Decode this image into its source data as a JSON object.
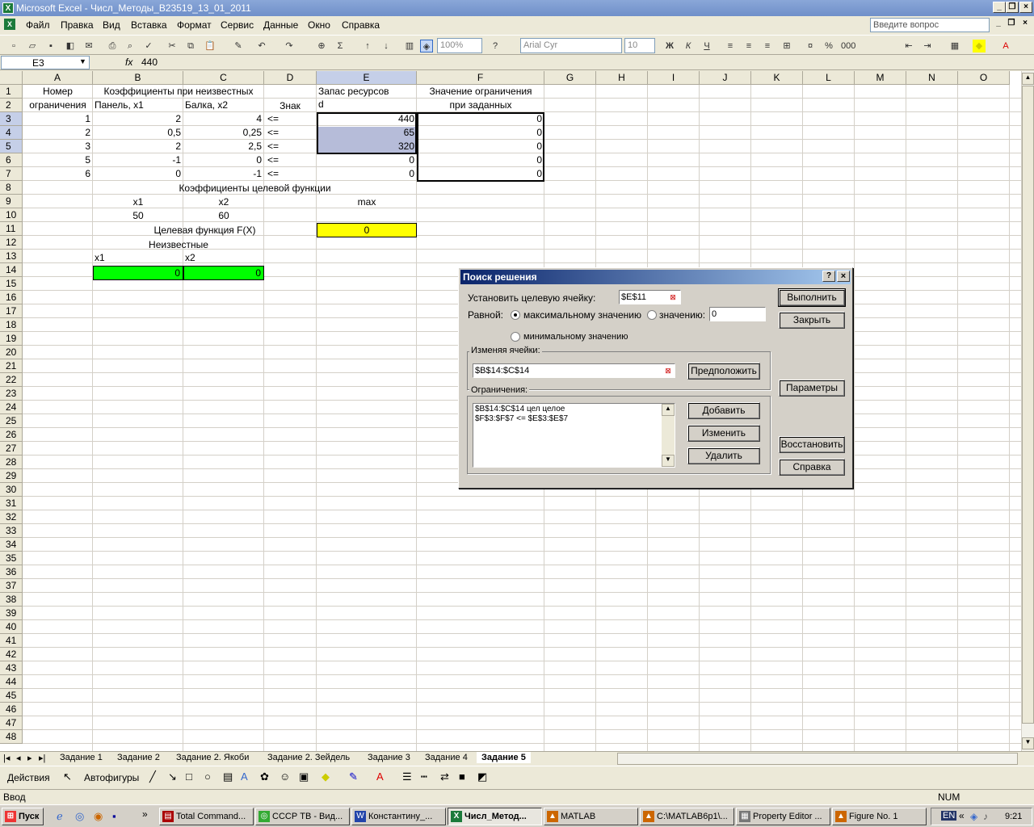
{
  "window": {
    "title": "Microsoft Excel - Числ_Методы_B23519_13_01_2011",
    "icon": "X"
  },
  "menu": [
    "Файл",
    "Правка",
    "Вид",
    "Вставка",
    "Формат",
    "Сервис",
    "Данные",
    "Окно",
    "Справка"
  ],
  "askbox": "Введите вопрос",
  "toolbar": {
    "zoom": "100%",
    "font": "Arial Cyr",
    "size": "10",
    "bold": "Ж",
    "italic": "К",
    "underline": "Ч"
  },
  "formula": {
    "cell": "E3",
    "fx": "fx",
    "value": "440"
  },
  "columns": [
    "A",
    "B",
    "C",
    "D",
    "E",
    "F",
    "G",
    "H",
    "I",
    "J",
    "K",
    "L",
    "M",
    "N",
    "O"
  ],
  "rows": [
    "1",
    "2",
    "3",
    "4",
    "5",
    "6",
    "7",
    "8",
    "9",
    "10",
    "11",
    "12",
    "13",
    "14",
    "15",
    "16",
    "17",
    "18",
    "19",
    "20",
    "21",
    "22",
    "23",
    "24",
    "25",
    "26",
    "27",
    "28",
    "29",
    "30",
    "31",
    "32",
    "33",
    "34",
    "35",
    "36",
    "37",
    "38",
    "39",
    "40",
    "41",
    "42",
    "43",
    "44",
    "45",
    "46",
    "47",
    "48"
  ],
  "sheet": {
    "A1": "Номер",
    "A2": "ограничения",
    "B1": "Коэффициенты при неизвестных",
    "B2": "Панель, x1",
    "C2": "Балка, x2",
    "D2": "Знак",
    "E1": "Запас ресурсов",
    "E2": "d",
    "F1": "Значение ограничения",
    "F2": "при заданных",
    "rows": [
      {
        "a": "1",
        "b": "2",
        "c": "4",
        "d": "<=",
        "e": "440",
        "f": "0"
      },
      {
        "a": "2",
        "b": "0,5",
        "c": "0,25",
        "d": "<=",
        "e": "65",
        "f": "0"
      },
      {
        "a": "3",
        "b": "2",
        "c": "2,5",
        "d": "<=",
        "e": "320",
        "f": "0"
      },
      {
        "a": "5",
        "b": "-1",
        "c": "0",
        "d": "<=",
        "e": "0",
        "f": "0"
      },
      {
        "a": "6",
        "b": "0",
        "c": "-1",
        "d": "<=",
        "e": "0",
        "f": "0"
      }
    ],
    "B8": "Коэффициенты целевой функции",
    "B9": "x1",
    "C9": "x2",
    "E9": "max",
    "B10": "50",
    "C10": "60",
    "B11": "Целевая функция F(X)",
    "E11": "0",
    "B12": "Неизвестные",
    "B13": "x1",
    "C13": "x2",
    "B14": "0",
    "C14": "0",
    "colors": {
      "yellow": "#ffff00",
      "green": "#00ff00",
      "selection": "#b6bcd9"
    }
  },
  "sheettabs": [
    "Задание 1",
    "Задание 2",
    "Задание 2. Якоби",
    "Задание 2. Зейдель",
    "Задание 3",
    "Задание 4",
    "Задание 5"
  ],
  "activeSheet": "Задание 5",
  "drawbar": {
    "actions": "Действия",
    "autoshapes": "Автофигуры"
  },
  "status": {
    "left": "Ввод",
    "num": "NUM"
  },
  "taskbar": {
    "start": "Пуск",
    "tasks": [
      "Total Command...",
      "СССР ТВ - Вид...",
      "Константину_...",
      "Числ_Метод...",
      "MATLAB",
      "C:\\MATLAB6p1\\...",
      "Property Editor ...",
      "Figure No. 1"
    ],
    "lang": "EN",
    "time": "9:21"
  },
  "dialog": {
    "title": "Поиск решения",
    "target_label": "Установить целевую ячейку:",
    "target_value": "$E$11",
    "equal_label": "Равной:",
    "opt_max": "максимальному значению",
    "opt_value": "значению:",
    "opt_value_input": "0",
    "opt_min": "минимальному значению",
    "changing_label": "Изменяя ячейки:",
    "changing_value": "$B$14:$C$14",
    "guess": "Предположить",
    "constraints_label": "Ограничения:",
    "constraints": [
      "$B$14:$C$14 цел целое",
      "$F$3:$F$7 <= $E$3:$E$7"
    ],
    "add": "Добавить",
    "change": "Изменить",
    "delete": "Удалить",
    "solve": "Выполнить",
    "close": "Закрыть",
    "options": "Параметры",
    "reset": "Восстановить",
    "help": "Справка"
  }
}
